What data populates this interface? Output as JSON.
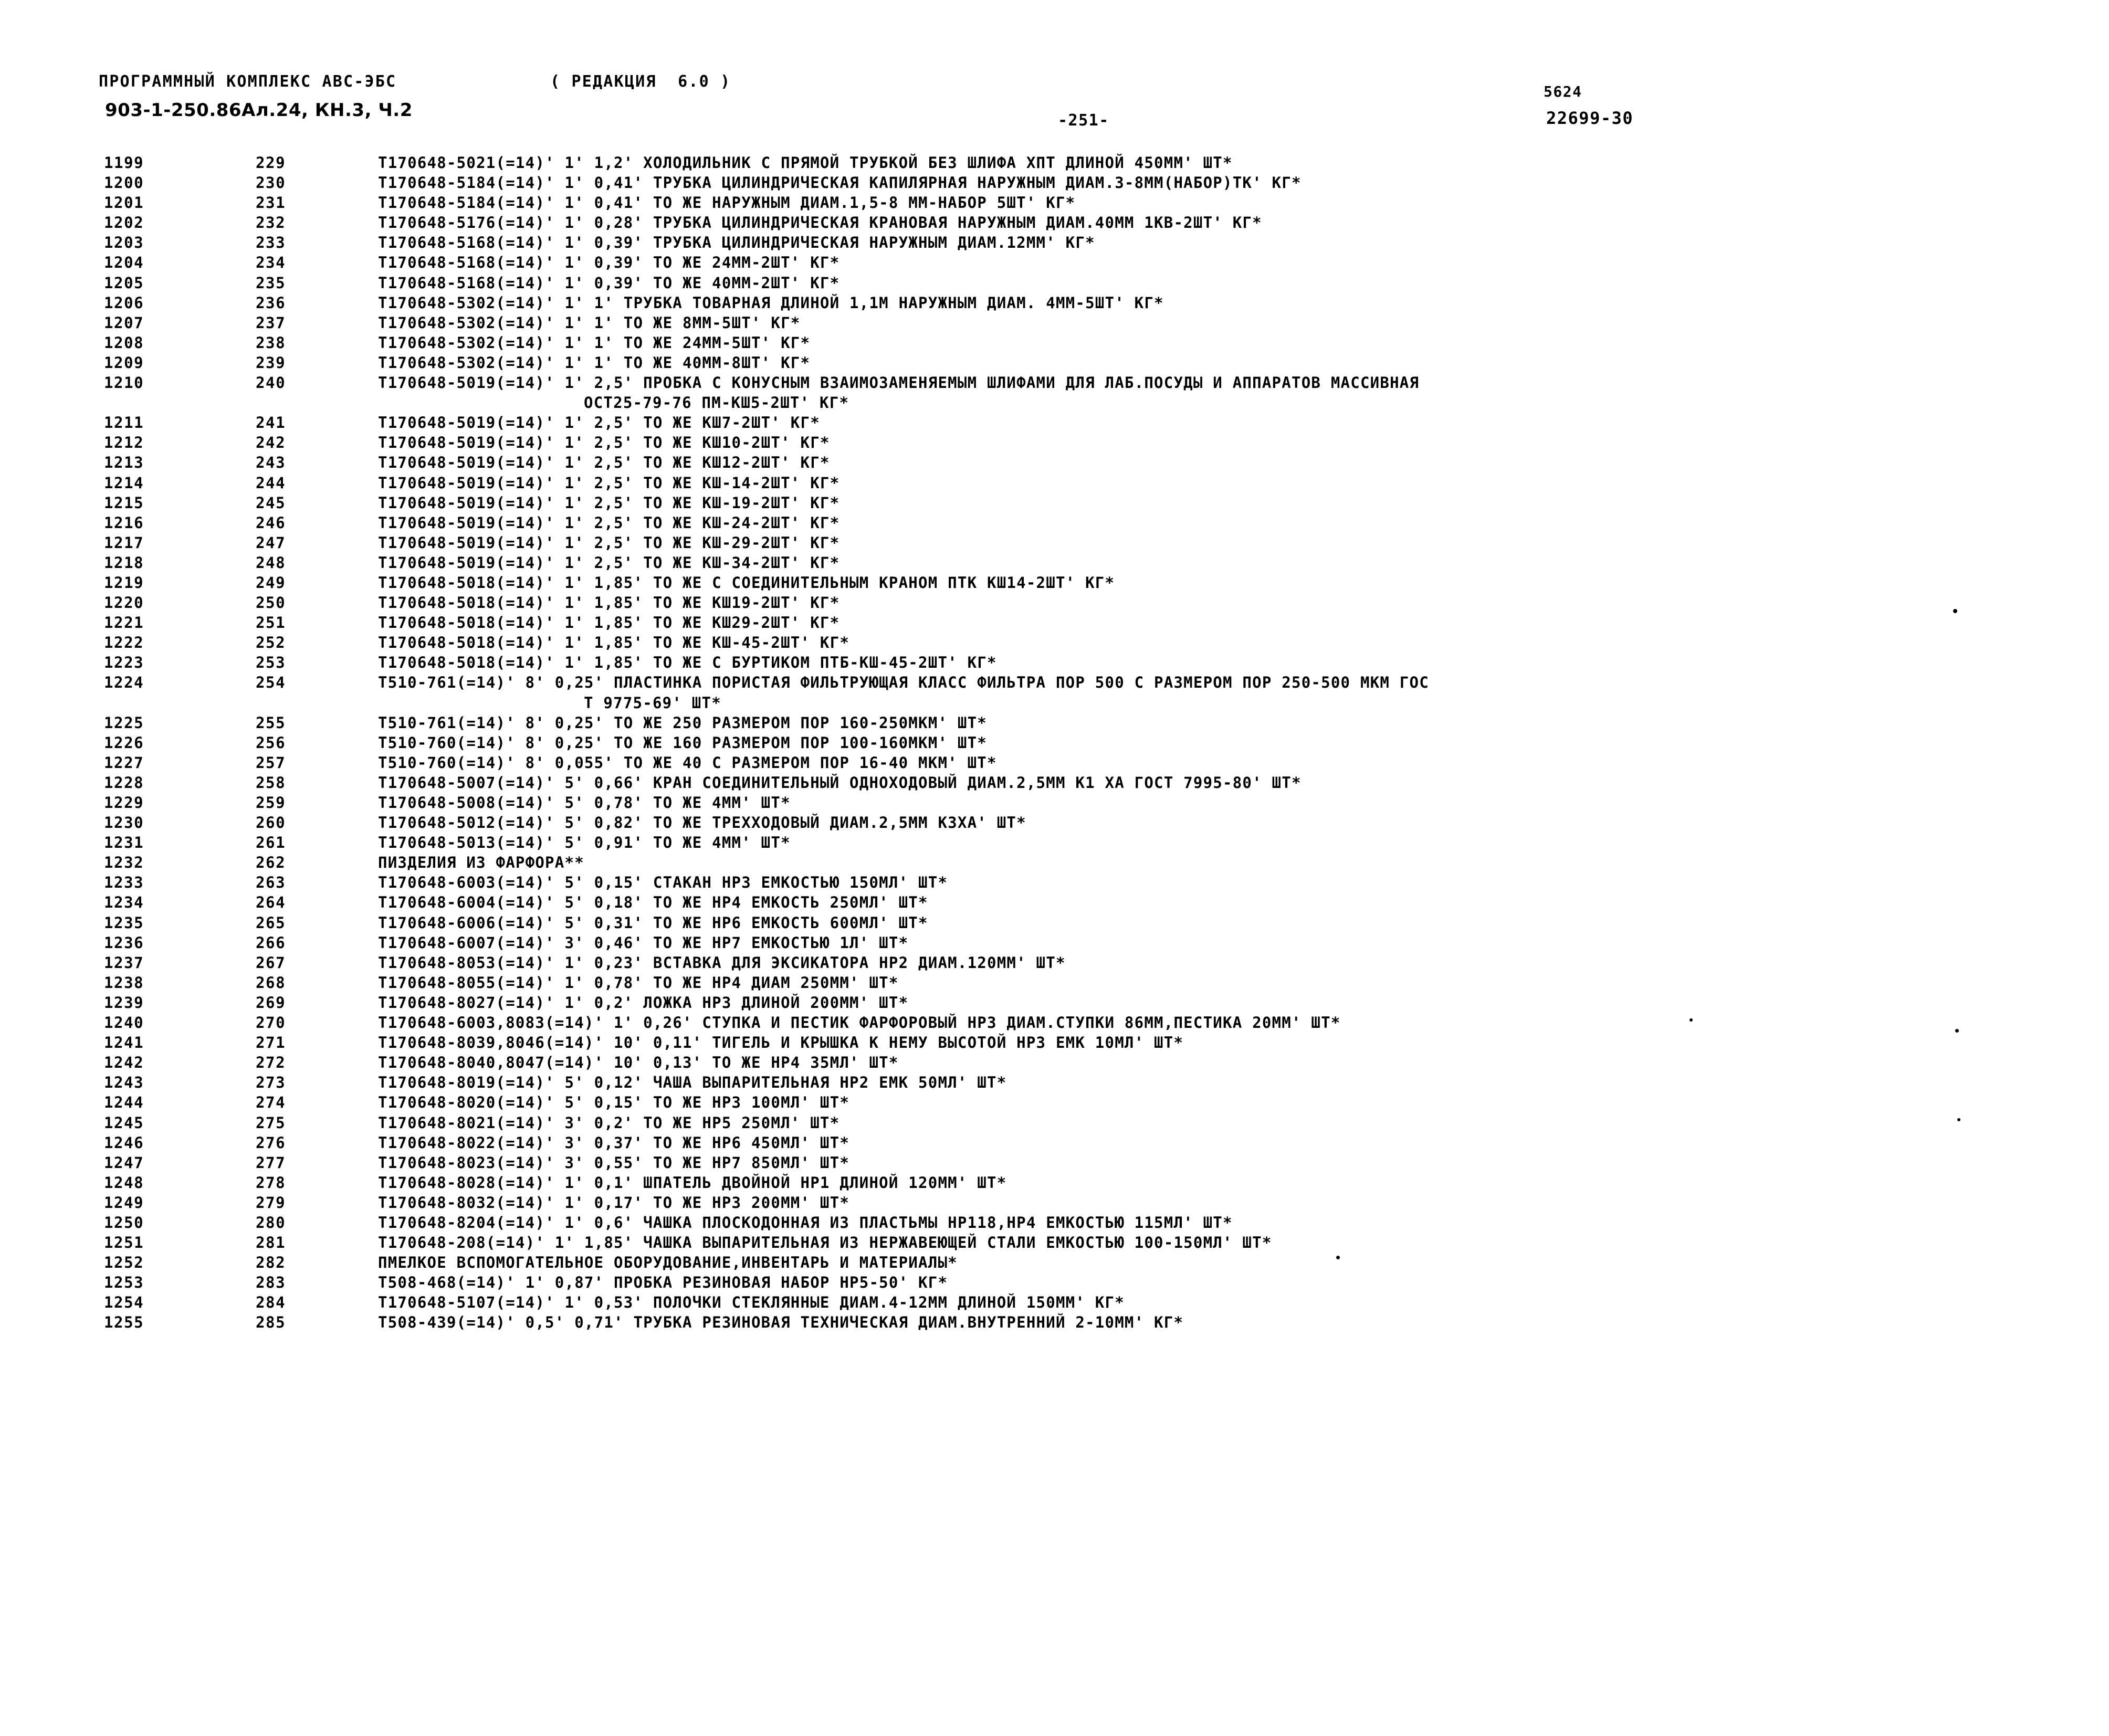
{
  "header": {
    "program_line": "ПРОГРАММНЫЙ КОМПЛЕКС АВС-ЭБС",
    "redaction": "( РЕДАКЦИЯ  6.0 )",
    "album": "903-1-250.86Ал.24, КН.3, Ч.2",
    "page_mark": "-251-",
    "doc_number_top": "5624",
    "doc_number_main": "22699-30"
  },
  "columns": {
    "line_header": "",
    "item_header": "",
    "desc_header": ""
  },
  "rows": [
    {
      "line": "1199",
      "item": "229",
      "desc": "Т170648-5021(=14)' 1' 1,2' ХОЛОДИЛЬНИК С ПРЯМОЙ ТРУБКОЙ БЕЗ ШЛИФА ХПТ ДЛИНОЙ 450ММ' ШТ*",
      "cont": false
    },
    {
      "line": "1200",
      "item": "230",
      "desc": "Т170648-5184(=14)' 1' 0,41' ТРУБКА ЦИЛИНДРИЧЕСКАЯ КАПИЛЯРНАЯ НАРУЖНЫМ ДИАМ.3-8ММ(НАБОР)ТК' КГ*",
      "cont": false
    },
    {
      "line": "1201",
      "item": "231",
      "desc": "Т170648-5184(=14)' 1' 0,41' ТО ЖЕ НАРУЖНЫМ ДИАМ.1,5-8 ММ-НАБОР 5ШТ' КГ*",
      "cont": false
    },
    {
      "line": "1202",
      "item": "232",
      "desc": "Т170648-5176(=14)' 1' 0,28' ТРУБКА ЦИЛИНДРИЧЕСКАЯ КРАНОВАЯ НАРУЖНЫМ ДИАМ.40ММ 1КВ-2ШТ' КГ*",
      "cont": false
    },
    {
      "line": "1203",
      "item": "233",
      "desc": "Т170648-5168(=14)' 1' 0,39' ТРУБКА ЦИЛИНДРИЧЕСКАЯ НАРУЖНЫМ ДИАМ.12ММ' КГ*",
      "cont": false
    },
    {
      "line": "1204",
      "item": "234",
      "desc": "Т170648-5168(=14)' 1' 0,39' ТО ЖЕ 24ММ-2ШТ' КГ*",
      "cont": false
    },
    {
      "line": "1205",
      "item": "235",
      "desc": "Т170648-5168(=14)' 1' 0,39' ТО ЖЕ 40ММ-2ШТ' КГ*",
      "cont": false
    },
    {
      "line": "1206",
      "item": "236",
      "desc": "Т170648-5302(=14)' 1' 1' ТРУБКА ТОВАРНАЯ ДЛИНОЙ 1,1М НАРУЖНЫМ ДИАМ. 4ММ-5ШТ' КГ*",
      "cont": false
    },
    {
      "line": "1207",
      "item": "237",
      "desc": "Т170648-5302(=14)' 1' 1' ТО ЖЕ 8ММ-5ШТ' КГ*",
      "cont": false
    },
    {
      "line": "1208",
      "item": "238",
      "desc": "Т170648-5302(=14)' 1' 1' ТО ЖЕ 24ММ-5ШТ' КГ*",
      "cont": false
    },
    {
      "line": "1209",
      "item": "239",
      "desc": "Т170648-5302(=14)' 1' 1' ТО ЖЕ 40ММ-8ШТ' КГ*",
      "cont": false
    },
    {
      "line": "1210",
      "item": "240",
      "desc": "Т170648-5019(=14)' 1' 2,5' ПРОБКА С КОНУСНЫМ ВЗАИМОЗАМЕНЯЕМЫМ ШЛИФАМИ ДЛЯ ЛАБ.ПОСУДЫ И АППАРАТОВ МАССИВНАЯ",
      "cont": false
    },
    {
      "line": "",
      "item": "",
      "desc": "ОСТ25-79-76 ПМ-КШ5-2ШТ' КГ*",
      "cont": true
    },
    {
      "line": "1211",
      "item": "241",
      "desc": "Т170648-5019(=14)' 1' 2,5' ТО ЖЕ КШ7-2ШТ' КГ*",
      "cont": false
    },
    {
      "line": "1212",
      "item": "242",
      "desc": "Т170648-5019(=14)' 1' 2,5' ТО ЖЕ КШ10-2ШТ' КГ*",
      "cont": false
    },
    {
      "line": "1213",
      "item": "243",
      "desc": "Т170648-5019(=14)' 1' 2,5' ТО ЖЕ КШ12-2ШТ' КГ*",
      "cont": false
    },
    {
      "line": "1214",
      "item": "244",
      "desc": "Т170648-5019(=14)' 1' 2,5' ТО ЖЕ КШ-14-2ШТ' КГ*",
      "cont": false
    },
    {
      "line": "1215",
      "item": "245",
      "desc": "Т170648-5019(=14)' 1' 2,5' ТО ЖЕ КШ-19-2ШТ' КГ*",
      "cont": false
    },
    {
      "line": "1216",
      "item": "246",
      "desc": "Т170648-5019(=14)' 1' 2,5' ТО ЖЕ КШ-24-2ШТ' КГ*",
      "cont": false
    },
    {
      "line": "1217",
      "item": "247",
      "desc": "Т170648-5019(=14)' 1' 2,5' ТО ЖЕ КШ-29-2ШТ' КГ*",
      "cont": false
    },
    {
      "line": "1218",
      "item": "248",
      "desc": "Т170648-5019(=14)' 1' 2,5' ТО ЖЕ КШ-34-2ШТ' КГ*",
      "cont": false
    },
    {
      "line": "1219",
      "item": "249",
      "desc": "Т170648-5018(=14)' 1' 1,85' ТО ЖЕ С СОЕДИНИТЕЛЬНЫМ КРАНОМ ПТК КШ14-2ШТ' КГ*",
      "cont": false
    },
    {
      "line": "1220",
      "item": "250",
      "desc": "Т170648-5018(=14)' 1' 1,85' ТО ЖЕ КШ19-2ШТ' КГ*",
      "cont": false
    },
    {
      "line": "1221",
      "item": "251",
      "desc": "Т170648-5018(=14)' 1' 1,85' ТО ЖЕ КШ29-2ШТ' КГ*",
      "cont": false
    },
    {
      "line": "1222",
      "item": "252",
      "desc": "Т170648-5018(=14)' 1' 1,85' ТО ЖЕ КШ-45-2ШТ' КГ*",
      "cont": false
    },
    {
      "line": "1223",
      "item": "253",
      "desc": "Т170648-5018(=14)' 1' 1,85' ТО ЖЕ С БУРТИКОМ ПТБ-КШ-45-2ШТ' КГ*",
      "cont": false
    },
    {
      "line": "1224",
      "item": "254",
      "desc": "Т510-761(=14)' 8' 0,25' ПЛАСТИНКА ПОРИСТАЯ ФИЛЬТРУЮЩАЯ КЛАСС ФИЛЬТРА ПОР 500 С РАЗМЕРОМ ПОР 250-500 МКМ ГОС",
      "cont": false
    },
    {
      "line": "",
      "item": "",
      "desc": "Т 9775-69' ШТ*",
      "cont": true
    },
    {
      "line": "1225",
      "item": "255",
      "desc": "Т510-761(=14)' 8' 0,25' ТО ЖЕ 250 РАЗМЕРОМ ПОР 160-250МКМ' ШТ*",
      "cont": false
    },
    {
      "line": "1226",
      "item": "256",
      "desc": "Т510-760(=14)' 8' 0,25' ТО ЖЕ 160 РАЗМЕРОМ ПОР 100-160МКМ' ШТ*",
      "cont": false
    },
    {
      "line": "1227",
      "item": "257",
      "desc": "Т510-760(=14)' 8' 0,055' ТО ЖЕ 40 С РАЗМЕРОМ ПОР 16-40 МКМ' ШТ*",
      "cont": false
    },
    {
      "line": "1228",
      "item": "258",
      "desc": "Т170648-5007(=14)' 5' 0,66' КРАН СОЕДИНИТЕЛЬНЫЙ ОДНОХОДОВЫЙ ДИАМ.2,5ММ К1 ХА ГОСТ 7995-80' ШТ*",
      "cont": false
    },
    {
      "line": "1229",
      "item": "259",
      "desc": "Т170648-5008(=14)' 5' 0,78' ТО ЖЕ 4ММ' ШТ*",
      "cont": false
    },
    {
      "line": "1230",
      "item": "260",
      "desc": "Т170648-5012(=14)' 5' 0,82' ТО ЖЕ ТРЕХХОДОВЫЙ ДИАМ.2,5ММ К3ХА' ШТ*",
      "cont": false
    },
    {
      "line": "1231",
      "item": "261",
      "desc": "Т170648-5013(=14)' 5' 0,91' ТО ЖЕ 4ММ' ШТ*",
      "cont": false
    },
    {
      "line": "1232",
      "item": "262",
      "desc": "ПИЗДЕЛИЯ ИЗ ФАРФОРА**",
      "cont": false
    },
    {
      "line": "1233",
      "item": "263",
      "desc": "Т170648-6003(=14)' 5' 0,15' СТАКАН НР3 ЕМКОСТЬЮ 150МЛ' ШТ*",
      "cont": false
    },
    {
      "line": "1234",
      "item": "264",
      "desc": "Т170648-6004(=14)' 5' 0,18' ТО ЖЕ НР4 ЕМКОСТЬ 250МЛ' ШТ*",
      "cont": false
    },
    {
      "line": "1235",
      "item": "265",
      "desc": "Т170648-6006(=14)' 5' 0,31' ТО ЖЕ НР6 ЕМКОСТЬ 600МЛ' ШТ*",
      "cont": false
    },
    {
      "line": "1236",
      "item": "266",
      "desc": "Т170648-6007(=14)' 3' 0,46' ТО ЖЕ НР7 ЕМКОСТЬЮ 1Л' ШТ*",
      "cont": false
    },
    {
      "line": "1237",
      "item": "267",
      "desc": "Т170648-8053(=14)' 1' 0,23' ВСТАВКА ДЛЯ ЭКСИКАТОРА НР2 ДИАМ.120ММ' ШТ*",
      "cont": false
    },
    {
      "line": "1238",
      "item": "268",
      "desc": "Т170648-8055(=14)' 1' 0,78' ТО ЖЕ НР4 ДИАМ 250ММ' ШТ*",
      "cont": false
    },
    {
      "line": "1239",
      "item": "269",
      "desc": "Т170648-8027(=14)' 1' 0,2' ЛОЖКА НР3 ДЛИНОЙ 200ММ' ШТ*",
      "cont": false
    },
    {
      "line": "1240",
      "item": "270",
      "desc": "Т170648-6003,8083(=14)' 1' 0,26' СТУПКА И ПЕСТИК ФАРФОРОВЫЙ НР3 ДИАМ.СТУПКИ 86ММ,ПЕСТИКА 20ММ' ШТ*",
      "cont": false
    },
    {
      "line": "1241",
      "item": "271",
      "desc": "Т170648-8039,8046(=14)' 10' 0,11' ТИГЕЛЬ И КРЫШКА К НЕМУ ВЫСОТОЙ НР3 ЕМК 10МЛ' ШТ*",
      "cont": false
    },
    {
      "line": "1242",
      "item": "272",
      "desc": "Т170648-8040,8047(=14)' 10' 0,13' ТО ЖЕ НР4 35МЛ' ШТ*",
      "cont": false
    },
    {
      "line": "1243",
      "item": "273",
      "desc": "Т170648-8019(=14)' 5' 0,12' ЧАША ВЫПАРИТЕЛЬНАЯ НР2 ЕМК 50МЛ' ШТ*",
      "cont": false
    },
    {
      "line": "1244",
      "item": "274",
      "desc": "Т170648-8020(=14)' 5' 0,15' ТО ЖЕ НР3 100МЛ' ШТ*",
      "cont": false
    },
    {
      "line": "1245",
      "item": "275",
      "desc": "Т170648-8021(=14)' 3' 0,2' ТО ЖЕ НР5 250МЛ' ШТ*",
      "cont": false
    },
    {
      "line": "1246",
      "item": "276",
      "desc": "Т170648-8022(=14)' 3' 0,37' ТО ЖЕ НР6 450МЛ' ШТ*",
      "cont": false
    },
    {
      "line": "1247",
      "item": "277",
      "desc": "Т170648-8023(=14)' 3' 0,55' ТО ЖЕ НР7 850МЛ' ШТ*",
      "cont": false
    },
    {
      "line": "1248",
      "item": "278",
      "desc": "Т170648-8028(=14)' 1' 0,1' ШПАТЕЛЬ ДВОЙНОЙ НР1 ДЛИНОЙ 120ММ' ШТ*",
      "cont": false
    },
    {
      "line": "1249",
      "item": "279",
      "desc": "Т170648-8032(=14)' 1' 0,17' ТО ЖЕ НР3 200ММ' ШТ*",
      "cont": false
    },
    {
      "line": "1250",
      "item": "280",
      "desc": "Т170648-8204(=14)' 1' 0,6' ЧАШКА ПЛОСКОДОННАЯ ИЗ ПЛАСТЬМЫ НР118,НР4 ЕМКОСТЬЮ 115МЛ' ШТ*",
      "cont": false
    },
    {
      "line": "1251",
      "item": "281",
      "desc": "Т170648-208(=14)' 1' 1,85' ЧАШКА ВЫПАРИТЕЛЬНАЯ ИЗ НЕРЖАВЕЮЩЕЙ СТАЛИ ЕМКОСТЬЮ 100-150МЛ' ШТ*",
      "cont": false
    },
    {
      "line": "1252",
      "item": "282",
      "desc": "ПМЕЛКОЕ ВСПОМОГАТЕЛЬНОЕ ОБОРУДОВАНИЕ,ИНВЕНТАРЬ И МАТЕРИАЛЫ*",
      "cont": false
    },
    {
      "line": "1253",
      "item": "283",
      "desc": "Т508-468(=14)' 1' 0,87' ПРОБКА РЕЗИНОВАЯ НАБОР НР5-50' КГ*",
      "cont": false
    },
    {
      "line": "1254",
      "item": "284",
      "desc": "Т170648-5107(=14)' 1' 0,53' ПОЛОЧКИ СТЕКЛЯННЫЕ ДИАМ.4-12ММ ДЛИНОЙ 150ММ' КГ*",
      "cont": false
    },
    {
      "line": "1255",
      "item": "285",
      "desc": "Т508-439(=14)' 0,5' 0,71' ТРУБКА РЕЗИНОВАЯ ТЕХНИЧЕСКАЯ ДИАМ.ВНУТРЕННИЙ 2-10ММ' КГ*",
      "cont": false
    }
  ]
}
